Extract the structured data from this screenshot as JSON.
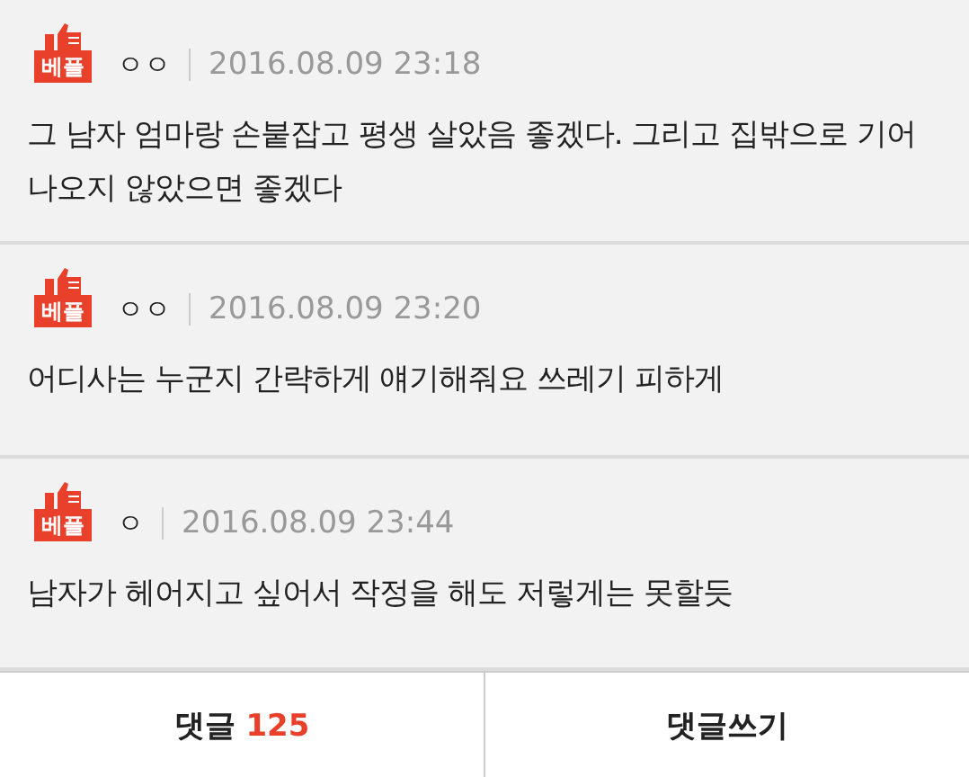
{
  "comments": [
    {
      "badge": "베플",
      "author": "ㅇㅇ",
      "date": "2016.08.09 23:18",
      "text": "그 남자 엄마랑 손붙잡고 평생 살았음 좋겠다. 그리고 집밖으로 기어나오지 않았으면 좋겠다"
    },
    {
      "badge": "베플",
      "author": "ㅇㅇ",
      "date": "2016.08.09 23:20",
      "text": "어디사는 누군지 간략하게 얘기해줘요 쓰레기 피하게"
    },
    {
      "badge": "베플",
      "author": "ㅇ",
      "date": "2016.08.09 23:44",
      "text": "남자가 헤어지고 싶어서 작정을 해도 저렇게는 못할듯"
    }
  ],
  "footer": {
    "comments_label": "댓글",
    "comments_count": "125",
    "write_label": "댓글쓰기"
  }
}
